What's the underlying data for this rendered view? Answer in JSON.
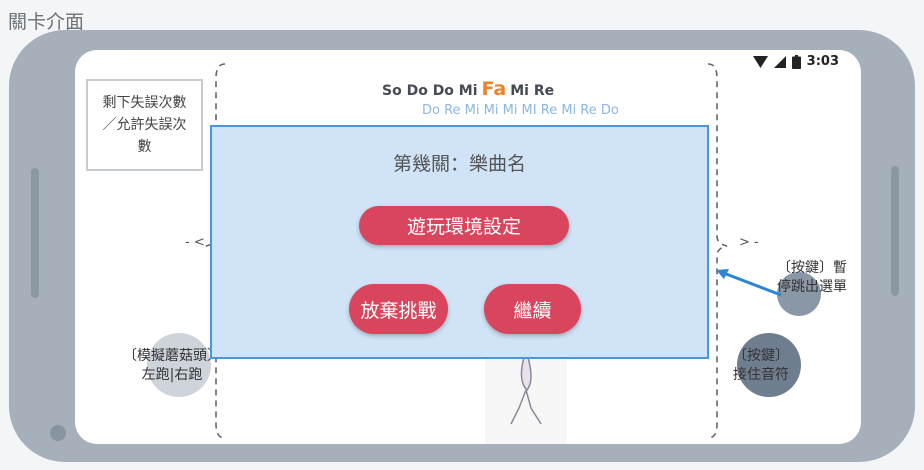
{
  "page": {
    "title": "關卡介面"
  },
  "status_bar": {
    "time": "3:03"
  },
  "hud": {
    "miss_counter": "剩下失誤次數／允許失誤次數",
    "notes_line1_before": "So Do Do Mi",
    "notes_current": "Fa",
    "notes_line1_after": "Mi Re",
    "notes_line2": "Do Re Mi Mi Mi MI Re Mi Re Do"
  },
  "labels": {
    "left_chevron": "- <",
    "right_chevron": "> -",
    "pause_hint": "〔按鍵〕暫停跳出選單",
    "left_control": "〔模擬蘑菇頭〕",
    "left_control_2": "左跑|右跑",
    "right_control": "〔按鍵〕",
    "right_control_2": "接住音符"
  },
  "dialog": {
    "title": "第幾關：樂曲名",
    "settings_button": "遊玩環境設定",
    "give_up_button": "放棄挑戰",
    "continue_button": "繼續"
  },
  "colors": {
    "accent": "#d8455d",
    "dialog_bg": "#d0e3f7",
    "dialog_border": "#4b95df",
    "current_note": "#f08226",
    "arrow": "#2d85d3"
  },
  "icons": [
    "wifi-icon",
    "signal-icon",
    "battery-icon",
    "arrow-icon"
  ]
}
